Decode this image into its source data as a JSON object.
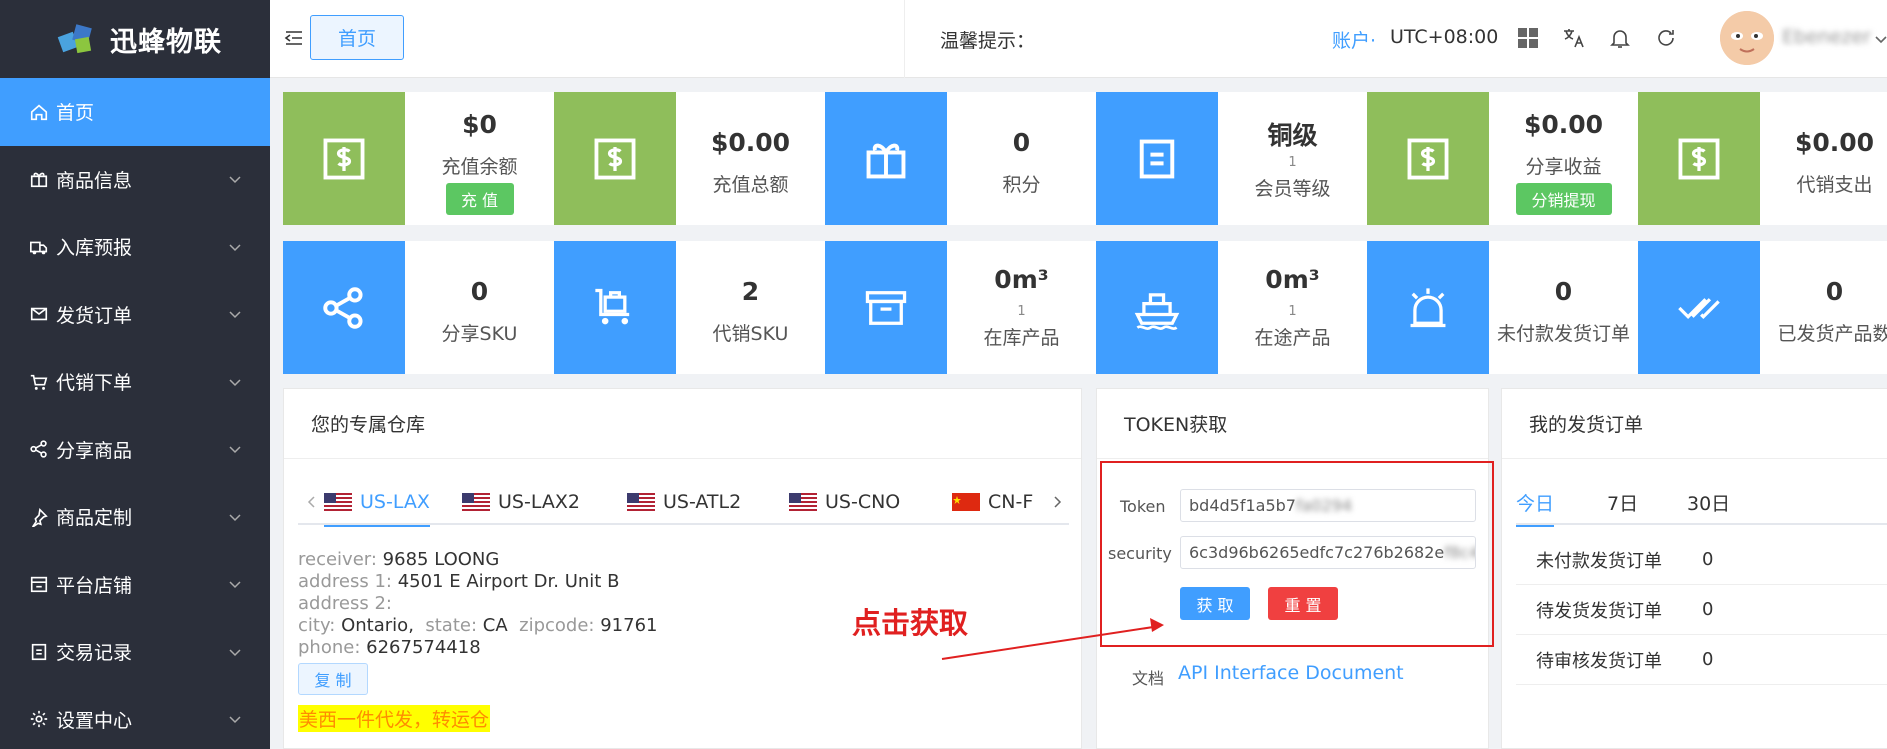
{
  "app": {
    "logo_text": "迅蜂物联"
  },
  "sidebar": {
    "items": [
      {
        "label": "首页",
        "icon": "home-icon",
        "active": true
      },
      {
        "label": "商品信息",
        "icon": "gift-icon"
      },
      {
        "label": "入库预报",
        "icon": "inbound-truck-icon"
      },
      {
        "label": "发货订单",
        "icon": "mail-send-icon"
      },
      {
        "label": "代销下单",
        "icon": "cart-icon"
      },
      {
        "label": "分享商品",
        "icon": "share-icon"
      },
      {
        "label": "商品定制",
        "icon": "pin-icon"
      },
      {
        "label": "平台店铺",
        "icon": "store-icon"
      },
      {
        "label": "交易记录",
        "icon": "document-icon"
      },
      {
        "label": "设置中心",
        "icon": "gear-icon"
      }
    ]
  },
  "header": {
    "home_tab": "首页",
    "notice": "温馨提示：",
    "account": "账户·",
    "timezone": "UTC+08:00",
    "username": "Ebenezer"
  },
  "stats_row1": [
    {
      "value": "$0",
      "label": "充值余额",
      "button": "充 值",
      "color": "#8fbe5b",
      "icon": "dollar-icon"
    },
    {
      "value": "$0.00",
      "label": "充值总额",
      "color": "#8fbe5b",
      "icon": "dollar-icon"
    },
    {
      "value": "0",
      "label": "积分",
      "color": "#409eff",
      "icon": "gift-icon"
    },
    {
      "value": "铜级",
      "sub": "1",
      "label": "会员等级",
      "color": "#409eff",
      "icon": "document-icon"
    },
    {
      "value": "$0.00",
      "label": "分享收益",
      "button": "分销提现",
      "color": "#8fbe5b",
      "icon": "dollar-icon"
    },
    {
      "value": "$0.00",
      "label": "代销支出",
      "color": "#8fbe5b",
      "icon": "dollar-icon"
    }
  ],
  "stats_row2": [
    {
      "value": "0",
      "label": "分享SKU",
      "color": "#409eff",
      "icon": "share-icon"
    },
    {
      "value": "2",
      "label": "代销SKU",
      "color": "#409eff",
      "icon": "luggage-cart-icon"
    },
    {
      "value": "0m³",
      "sub": "1",
      "label": "在库产品",
      "color": "#409eff",
      "icon": "warehouse-box-icon"
    },
    {
      "value": "0m³",
      "sub": "1",
      "label": "在途产品",
      "color": "#409eff",
      "icon": "ship-icon"
    },
    {
      "value": "0",
      "label": "未付款发货订单",
      "color": "#409eff",
      "icon": "alarm-icon"
    },
    {
      "value": "0",
      "label": "已发货产品数",
      "color": "#409eff",
      "icon": "double-check-icon"
    }
  ],
  "warehouse": {
    "title": "您的专属仓库",
    "tabs": [
      "US-LAX",
      "US-LAX2",
      "US-ATL2",
      "US-CNO",
      "CN-F"
    ],
    "active_tab": 0,
    "receiver_k": "receiver:",
    "receiver_v": "9685  LOONG",
    "address1_k": "address 1:",
    "address1_v": "4501 E Airport Dr. Unit B",
    "address2_k": "address 2:",
    "address2_v": "",
    "city_k": "city:",
    "city_v": "Ontario,",
    "state_k": "state:",
    "state_v": "CA",
    "zip_k": "zipcode:",
    "zip_v": "91761",
    "phone_k": "phone:",
    "phone_v": "6267574418",
    "copy": "复 制",
    "highlight": "美西一件代发，转运仓"
  },
  "token": {
    "title": "TOKEN获取",
    "token_label": "Token",
    "token_value": "bd4d5f1a5b7",
    "token_blur": "fa0294",
    "security_label": "security",
    "security_value": "6c3d96b6265edfc7c276b2682e",
    "security_blur": "f8c4b3",
    "get_btn": "获 取",
    "reset_btn": "重 置",
    "doc_label": "文档",
    "doc_link": "API Interface Document"
  },
  "orders": {
    "title": "我的发货订单",
    "tabs": [
      "今日",
      "7日",
      "30日"
    ],
    "active_tab": 0,
    "rows": [
      {
        "name": "未付款发货订单",
        "count": "0"
      },
      {
        "name": "待发货发货订单",
        "count": "0"
      },
      {
        "name": "待审核发货订单",
        "count": "0"
      }
    ]
  },
  "annotation": "点击获取"
}
